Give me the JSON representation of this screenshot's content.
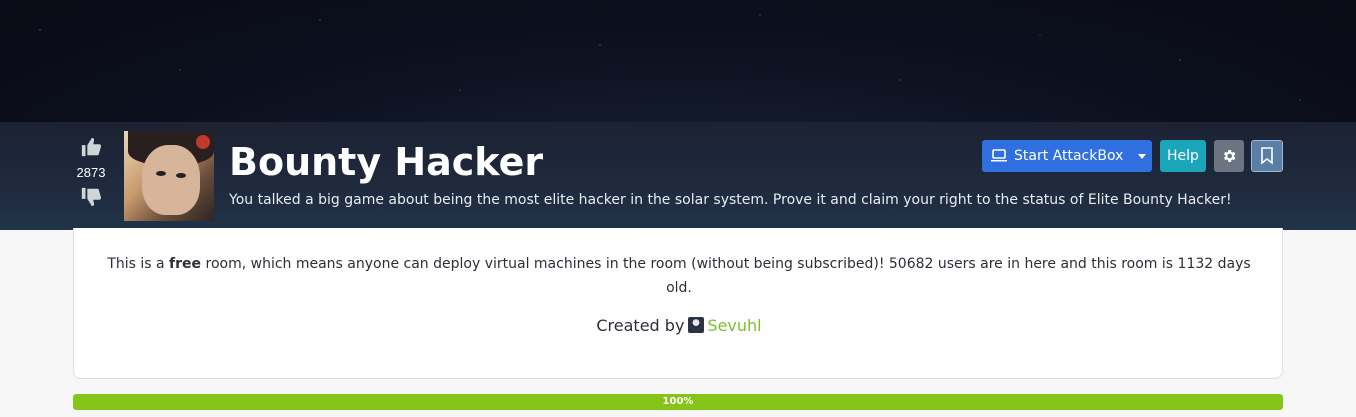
{
  "header": {
    "title": "Bounty Hacker",
    "description": "You talked a big game about being the most elite hacker in the solar system. Prove it and claim your right to the status of Elite Bounty Hacker!",
    "votes": "2873"
  },
  "toolbar": {
    "attackbox_label": "Start AttackBox",
    "help_label": "Help"
  },
  "icons": {
    "upvote": "thumbs-up-icon",
    "downvote": "thumbs-down-icon",
    "attackbox": "laptop-icon",
    "dropdown": "caret-down-icon",
    "settings": "gear-icon",
    "bookmark": "bookmark-icon"
  },
  "info": {
    "prefix": "This is a ",
    "free_word": "free",
    "suffix": " room, which means anyone can deploy virtual machines in the room (without being subscribed)! 50682 users are in here and this room is 1132 days old.",
    "created_by_label": "Created by",
    "creator_name": "Sevuhl"
  },
  "progress": {
    "value": 100,
    "label": "100%"
  },
  "colors": {
    "accent_blue": "#2f6fe0",
    "help_teal": "#1ba5b8",
    "progress_green": "#86c419",
    "creator_link": "#7fbf2d"
  }
}
